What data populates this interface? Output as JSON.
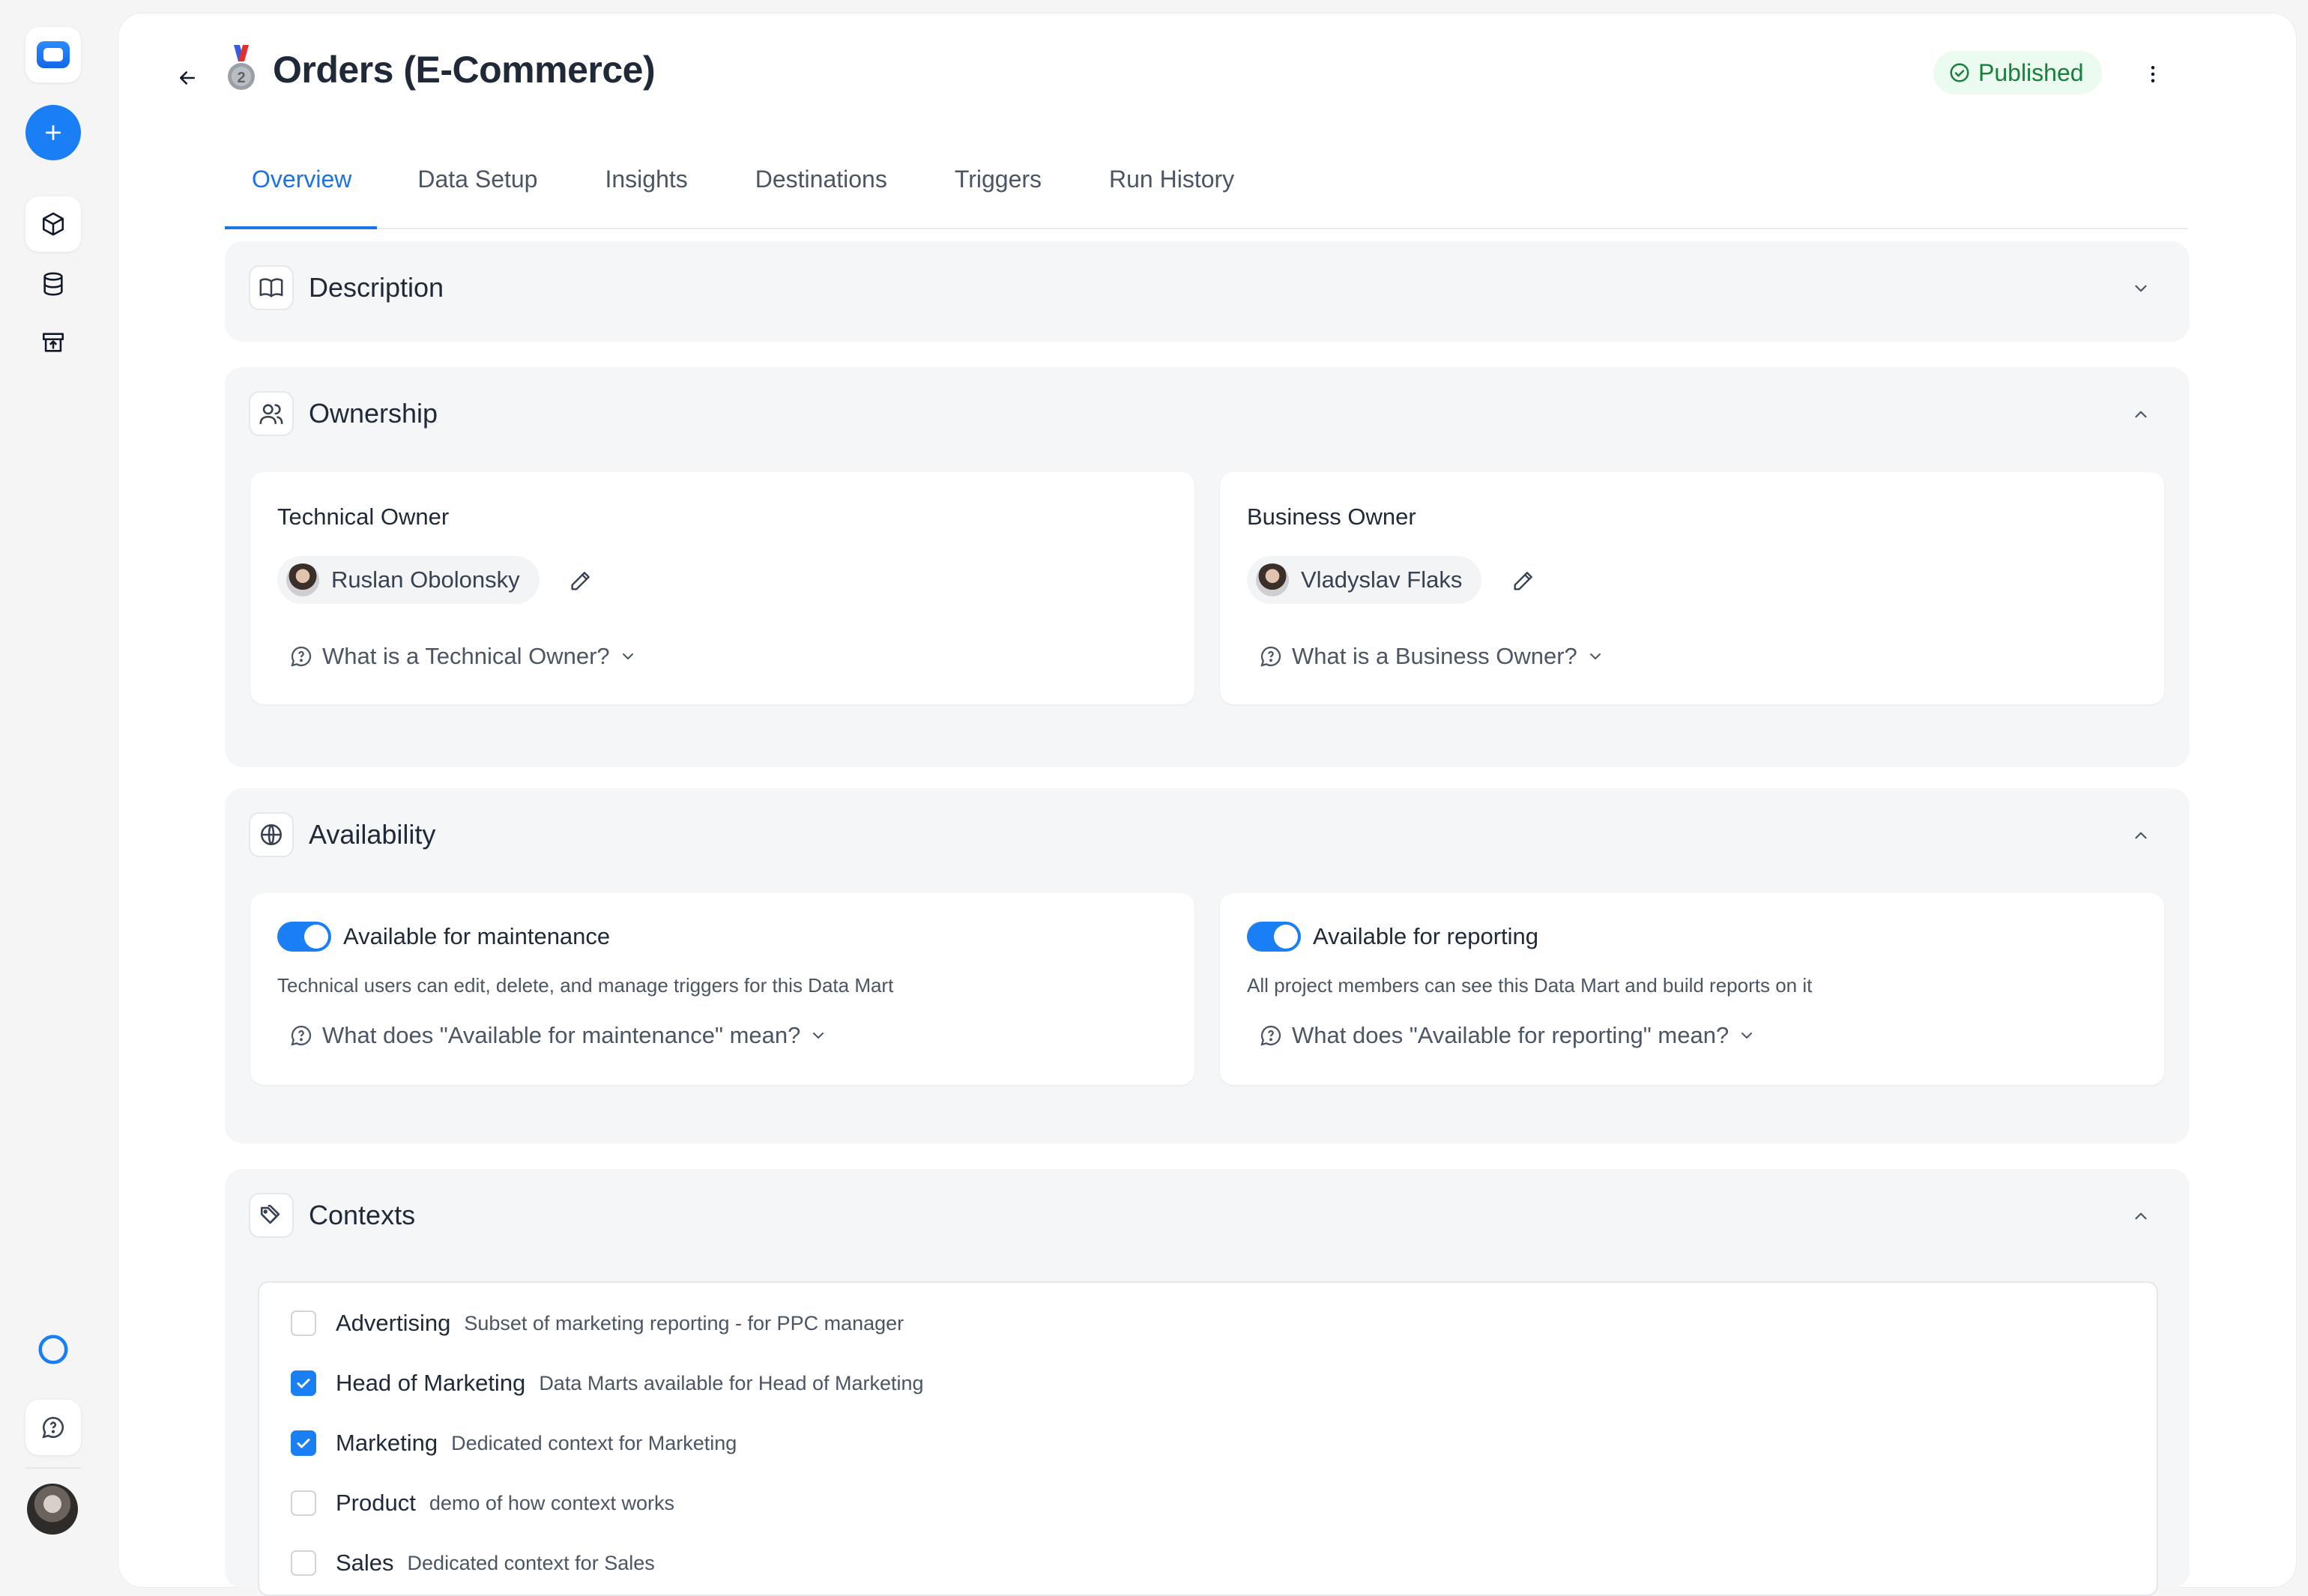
{
  "page": {
    "title": "Orders (E-Commerce)",
    "status": "Published"
  },
  "tabs": [
    {
      "label": "Overview",
      "active": true
    },
    {
      "label": "Data Setup"
    },
    {
      "label": "Insights"
    },
    {
      "label": "Destinations"
    },
    {
      "label": "Triggers"
    },
    {
      "label": "Run History"
    }
  ],
  "sections": {
    "description": {
      "title": "Description",
      "icon": "book-icon",
      "expanded": false
    },
    "ownership": {
      "title": "Ownership",
      "icon": "users-icon",
      "technical": {
        "label": "Technical Owner",
        "name": "Ruslan Obolonsky",
        "help": "What is a Technical Owner?"
      },
      "business": {
        "label": "Business Owner",
        "name": "Vladyslav Flaks",
        "help": "What is a Business Owner?"
      }
    },
    "availability": {
      "title": "Availability",
      "icon": "globe-icon",
      "maintenance": {
        "label": "Available for maintenance",
        "enabled": true,
        "desc": "Technical users can edit, delete, and manage triggers for this Data Mart",
        "help": "What does \"Available for maintenance\" mean?"
      },
      "reporting": {
        "label": "Available for reporting",
        "enabled": true,
        "desc": "All project members can see this Data Mart and build reports on it",
        "help": "What does \"Available for reporting\" mean?"
      }
    },
    "contexts": {
      "title": "Contexts",
      "icon": "tags-icon",
      "items": [
        {
          "name": "Advertising",
          "desc": "Subset of marketing reporting - for PPC manager",
          "checked": false
        },
        {
          "name": "Head of Marketing",
          "desc": "Data Marts available for Head of Marketing",
          "checked": true
        },
        {
          "name": "Marketing",
          "desc": "Dedicated context for Marketing",
          "checked": true
        },
        {
          "name": "Product",
          "desc": "demo of how context works",
          "checked": false
        },
        {
          "name": "Sales",
          "desc": "Dedicated context for Sales",
          "checked": false
        }
      ]
    }
  },
  "colors": {
    "accent": "#1a7ef5",
    "published_bg": "#ecfbf0",
    "published_text": "#17803d"
  }
}
